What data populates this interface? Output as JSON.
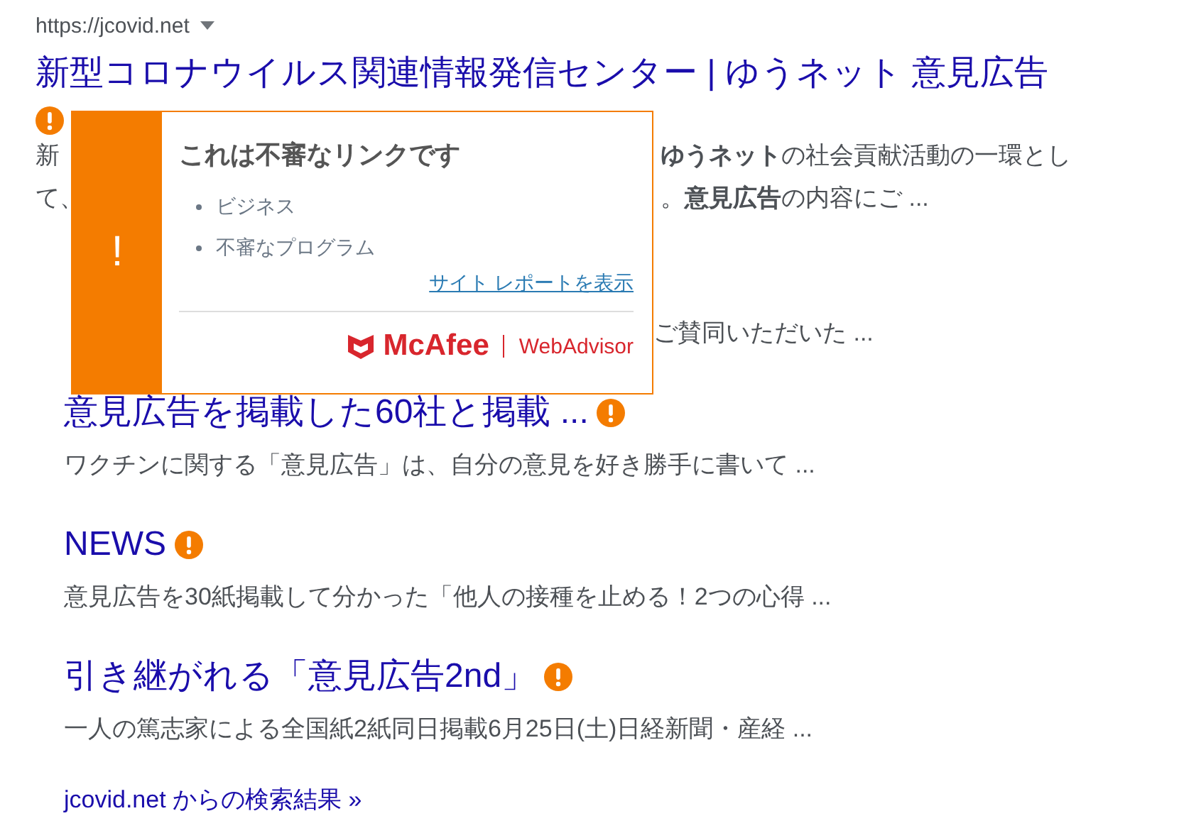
{
  "result": {
    "url": "https://jcovid.net",
    "title": "新型コロナウイルス関連情報発信センター | ゆうネット 意見広告",
    "warning": true,
    "snippet_lines": [
      {
        "left": "新",
        "right": "**ゆうネット**の社会貢献活動の一環とし"
      },
      {
        "left": "て、",
        "right": "。**意見広告**の内容にご ..."
      }
    ]
  },
  "covered_sublink": {
    "snippet_tail": "ご賛同いただいた ..."
  },
  "sublinks": [
    {
      "title": "意見広告を掲載した60社と掲載 ...",
      "warning": true,
      "snippet": "ワクチンに関する「意見広告」は、自分の意見を好き勝手に書いて ..."
    },
    {
      "title": "NEWS",
      "warning": true,
      "snippet": "意見広告を30紙掲載して分かった「他人の接種を止める！2つの心得 ..."
    },
    {
      "title": "引き継がれる「意見広告2nd」",
      "warning": true,
      "snippet": "一人の篤志家による全国紙2紙同日掲載6月25日(土)日経新聞・産経 ..."
    }
  ],
  "more_link": "jcovid.net からの検索結果 »",
  "popup": {
    "badge": "!",
    "title": "これは不審なリンクです",
    "categories": [
      "ビジネス",
      "不審なプログラム"
    ],
    "report_link": "サイト レポートを表示",
    "brand": "McAfee",
    "product": "WebAdvisor"
  }
}
